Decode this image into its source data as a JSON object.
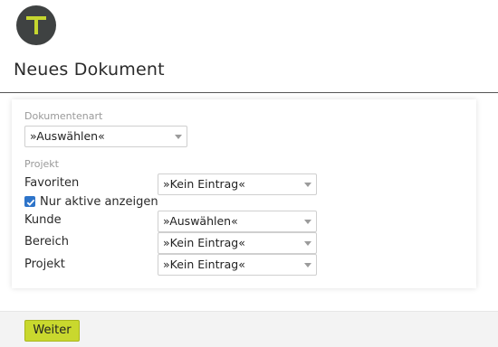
{
  "header": {
    "logo_icon": "t-logo-icon",
    "logo_letter": "T",
    "logo_colors": {
      "circle": "#3f4242",
      "letter": "#c6d62f"
    },
    "title": "Neues Dokument"
  },
  "form": {
    "dokumentenart": {
      "section_label": "Dokumentenart",
      "selected": "»Auswählen«"
    },
    "projekt_section_label": "Projekt",
    "favoriten": {
      "label": "Favoriten",
      "selected": "»Kein Eintrag«"
    },
    "nur_aktive": {
      "label": "Nur aktive anzeigen",
      "checked": true
    },
    "kunde": {
      "label": "Kunde",
      "selected": "»Auswählen«"
    },
    "bereich": {
      "label": "Bereich",
      "selected": "»Kein Eintrag«"
    },
    "projekt": {
      "label": "Projekt",
      "selected": "»Kein Eintrag«"
    }
  },
  "footer": {
    "weiter_label": "Weiter",
    "accent_color": "#c9d82e"
  }
}
